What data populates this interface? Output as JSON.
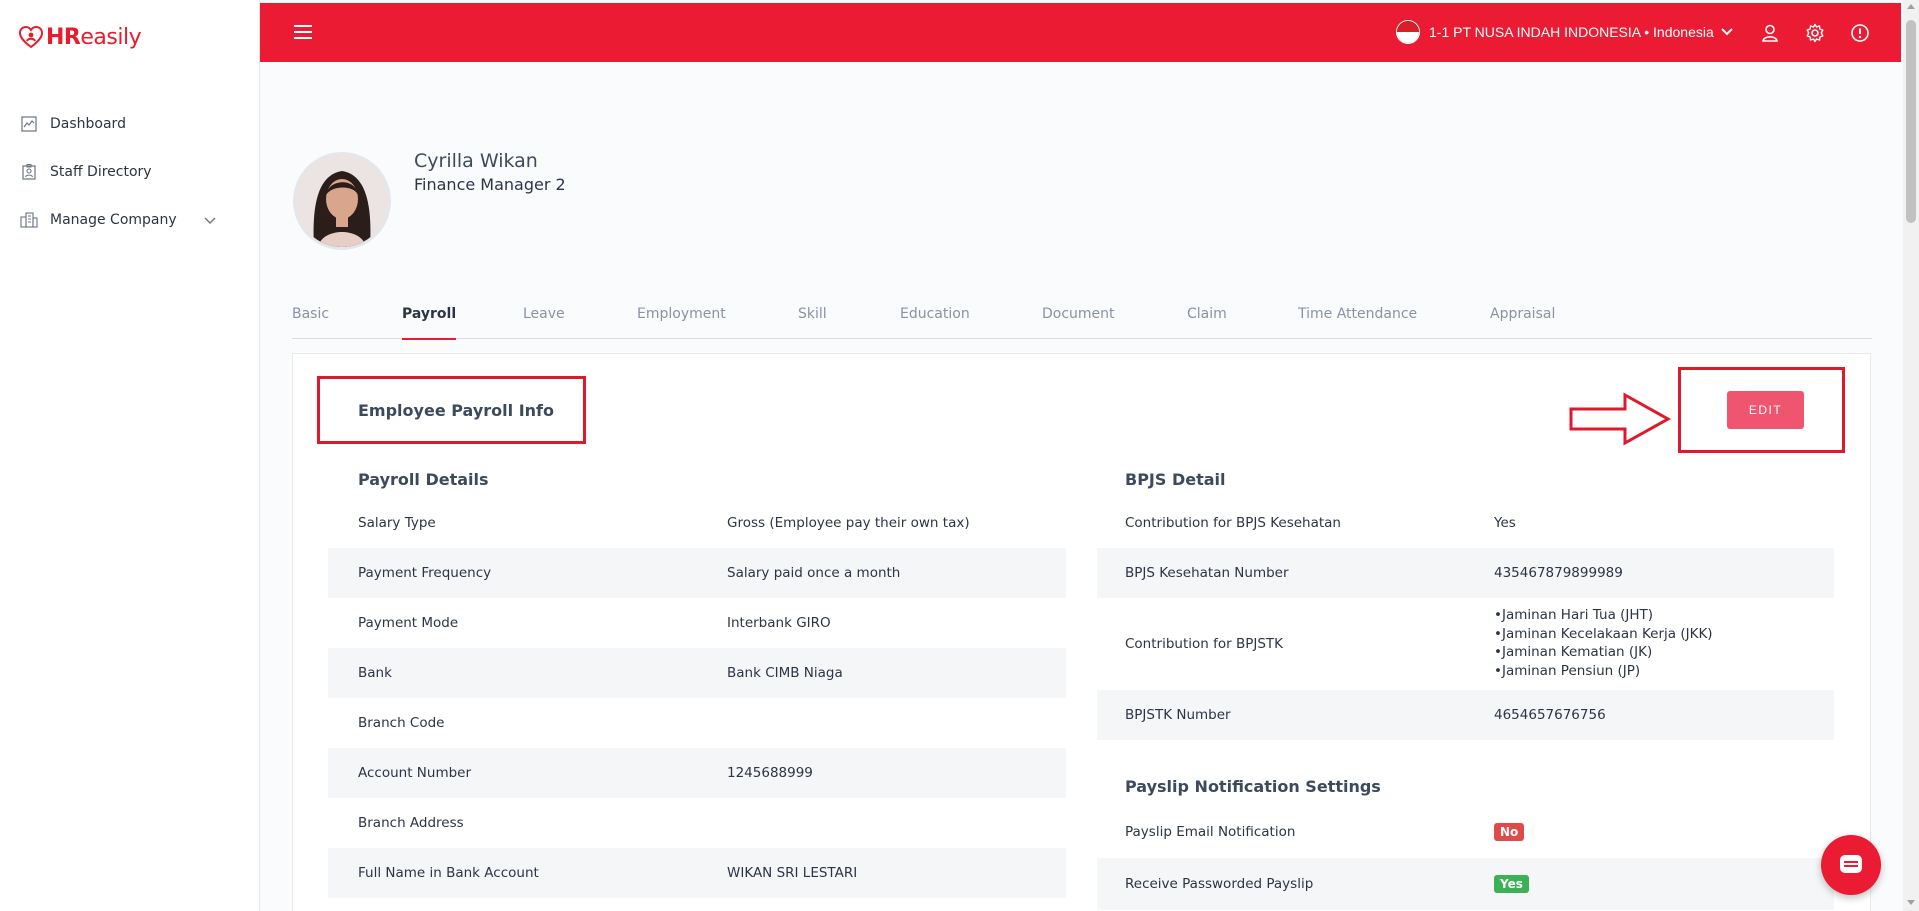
{
  "brand": {
    "logo_hr": "HR",
    "logo_easily": "easily",
    "accent": "#ea1b33"
  },
  "sidebar": {
    "items": [
      {
        "label": "Dashboard",
        "icon": "dashboard-chart-icon"
      },
      {
        "label": "Staff Directory",
        "icon": "staff-badge-icon"
      },
      {
        "label": "Manage Company",
        "icon": "building-icon",
        "expandable": true
      }
    ]
  },
  "topbar": {
    "company": "1-1 PT NUSA INDAH INDONESIA • Indonesia",
    "icons": [
      "menu-icon",
      "user-icon",
      "gear-icon",
      "help-icon"
    ]
  },
  "employee": {
    "name": "Cyrilla Wikan",
    "title": "Finance Manager 2"
  },
  "tabs": [
    {
      "label": "Basic",
      "active": false
    },
    {
      "label": "Payroll",
      "active": true
    },
    {
      "label": "Leave",
      "active": false
    },
    {
      "label": "Employment",
      "active": false
    },
    {
      "label": "Skill",
      "active": false
    },
    {
      "label": "Education",
      "active": false
    },
    {
      "label": "Document",
      "active": false
    },
    {
      "label": "Claim",
      "active": false
    },
    {
      "label": "Time Attendance",
      "active": false
    },
    {
      "label": "Appraisal",
      "active": false
    }
  ],
  "card": {
    "title": "Employee Payroll Info",
    "edit_label": "EDIT"
  },
  "payroll": {
    "heading": "Payroll Details",
    "rows": [
      {
        "label": "Salary Type",
        "value": "Gross (Employee pay their own tax)"
      },
      {
        "label": "Payment Frequency",
        "value": "Salary paid once a month"
      },
      {
        "label": "Payment Mode",
        "value": "Interbank GIRO"
      },
      {
        "label": "Bank",
        "value": "Bank CIMB Niaga"
      },
      {
        "label": "Branch Code",
        "value": ""
      },
      {
        "label": "Account Number",
        "value": "1245688999"
      },
      {
        "label": "Branch Address",
        "value": ""
      },
      {
        "label": "Full Name in Bank Account",
        "value": "WIKAN SRI LESTARI"
      }
    ]
  },
  "bpjs": {
    "heading": "BPJS Detail",
    "row1": {
      "label": "Contribution for BPJS Kesehatan",
      "value": "Yes"
    },
    "row2": {
      "label": "BPJS Kesehatan Number",
      "value": "435467879899989"
    },
    "row3": {
      "label": "Contribution for BPJSTK",
      "values": [
        "•Jaminan Hari Tua (JHT)",
        "•Jaminan Kecelakaan Kerja (JKK)",
        "•Jaminan Kematian (JK)",
        "•Jaminan Pensiun (JP)"
      ]
    },
    "row4": {
      "label": "BPJSTK Number",
      "value": "4654657676756"
    }
  },
  "payslip": {
    "heading": "Payslip Notification Settings",
    "email": {
      "label": "Payslip Email Notification",
      "value": "No"
    },
    "password": {
      "label": "Receive Passworded Payslip",
      "value": "Yes"
    }
  }
}
